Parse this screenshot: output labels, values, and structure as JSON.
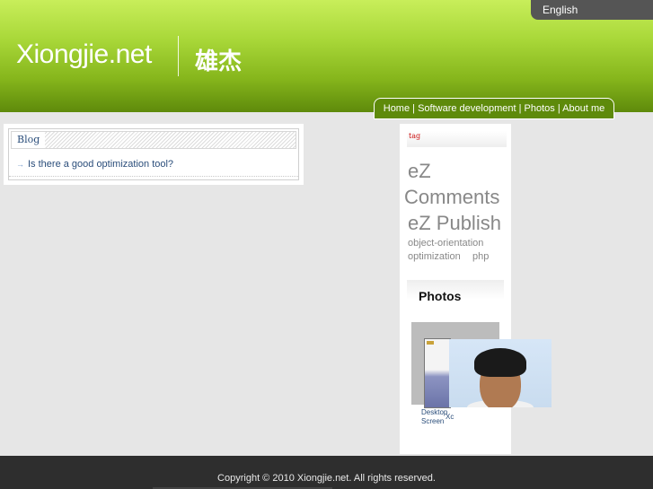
{
  "header": {
    "site_name": "Xiongjie.net",
    "site_name_cn": "雄杰",
    "language_label": "English"
  },
  "nav": {
    "items": [
      "Home",
      "Software development",
      "Photos",
      "About me"
    ],
    "separator": " | "
  },
  "blog": {
    "title": "Blog",
    "posts": [
      "Is there a good optimization tool?"
    ]
  },
  "tags": {
    "title": "tag",
    "items": [
      "eZ",
      "Comments",
      "eZ Publish",
      "object-orientation",
      "optimization",
      "php"
    ]
  },
  "photos": {
    "title": "Photos",
    "items": [
      {
        "caption_line1": "Desktop",
        "caption_line2": "Screen"
      },
      {
        "caption_line1": "Xc"
      }
    ]
  },
  "footer": {
    "copyright": "Copyright © 2010 Xiongjie.net. All rights reserved."
  },
  "colors": {
    "header_green": "#86b61c",
    "nav_green": "#5e8a0b",
    "footer_bg": "#2e2e2e",
    "link_blue": "#2a4d7a",
    "tag_gray": "#888888"
  }
}
